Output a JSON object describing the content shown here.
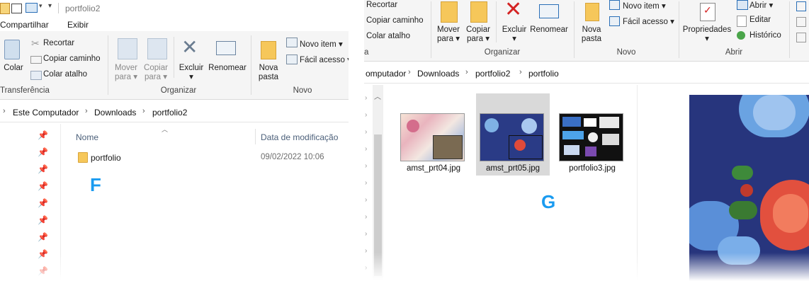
{
  "left": {
    "quick_access_tab": "Compartilhar",
    "view_tab": "Exibir",
    "title": "portfolio2",
    "ribbon": {
      "clipboard": {
        "paste": "Colar",
        "cut": "Recortar",
        "copy_path": "Copiar caminho",
        "paste_shortcut": "Colar atalho",
        "group": "Transferência"
      },
      "organize": {
        "move_to_1": "Mover",
        "move_to_2": "para",
        "copy_to_1": "Copiar",
        "copy_to_2": "para",
        "delete": "Excluir",
        "rename": "Renomear",
        "group": "Organizar"
      },
      "new": {
        "new_folder_1": "Nova",
        "new_folder_2": "pasta",
        "new_item": "Novo item",
        "easy_access": "Fácil acesso",
        "group": "Novo"
      }
    },
    "breadcrumb": [
      "Este Computador",
      "Downloads",
      "portfolio2"
    ],
    "columns": {
      "name": "Nome",
      "date": "Data de modificação"
    },
    "files": [
      {
        "name": "portfolio",
        "date": "09/02/2022 10:06"
      }
    ],
    "overlay_letter": "F"
  },
  "right": {
    "ribbon": {
      "clipboard": {
        "copy_path": "Copiar caminho",
        "paste_shortcut": "Colar atalho",
        "cut": "Recortar",
        "group": "a"
      },
      "organize": {
        "move_to_1": "Mover",
        "move_to_2": "para",
        "copy_to_1": "Copiar",
        "copy_to_2": "para",
        "delete": "Excluir",
        "rename": "Renomear",
        "group": "Organizar"
      },
      "new": {
        "new_folder_1": "Nova",
        "new_folder_2": "pasta",
        "new_item": "Novo item",
        "easy_access": "Fácil acesso",
        "group": "Novo"
      },
      "open": {
        "properties": "Propriedades",
        "open": "Abrir",
        "edit": "Editar",
        "history": "Histórico",
        "group": "Abrir"
      }
    },
    "breadcrumb": [
      "omputador",
      "Downloads",
      "portfolio2",
      "portfolio"
    ],
    "files": [
      {
        "name": "amst_prt04.jpg"
      },
      {
        "name": "amst_prt05.jpg"
      },
      {
        "name": "portfolio3.jpg"
      }
    ],
    "overlay_letter": "G"
  },
  "colors": {
    "accent": "#1a9bf0",
    "selected": "#cce8ff",
    "ribbon_bg": "#f5f5f5"
  }
}
